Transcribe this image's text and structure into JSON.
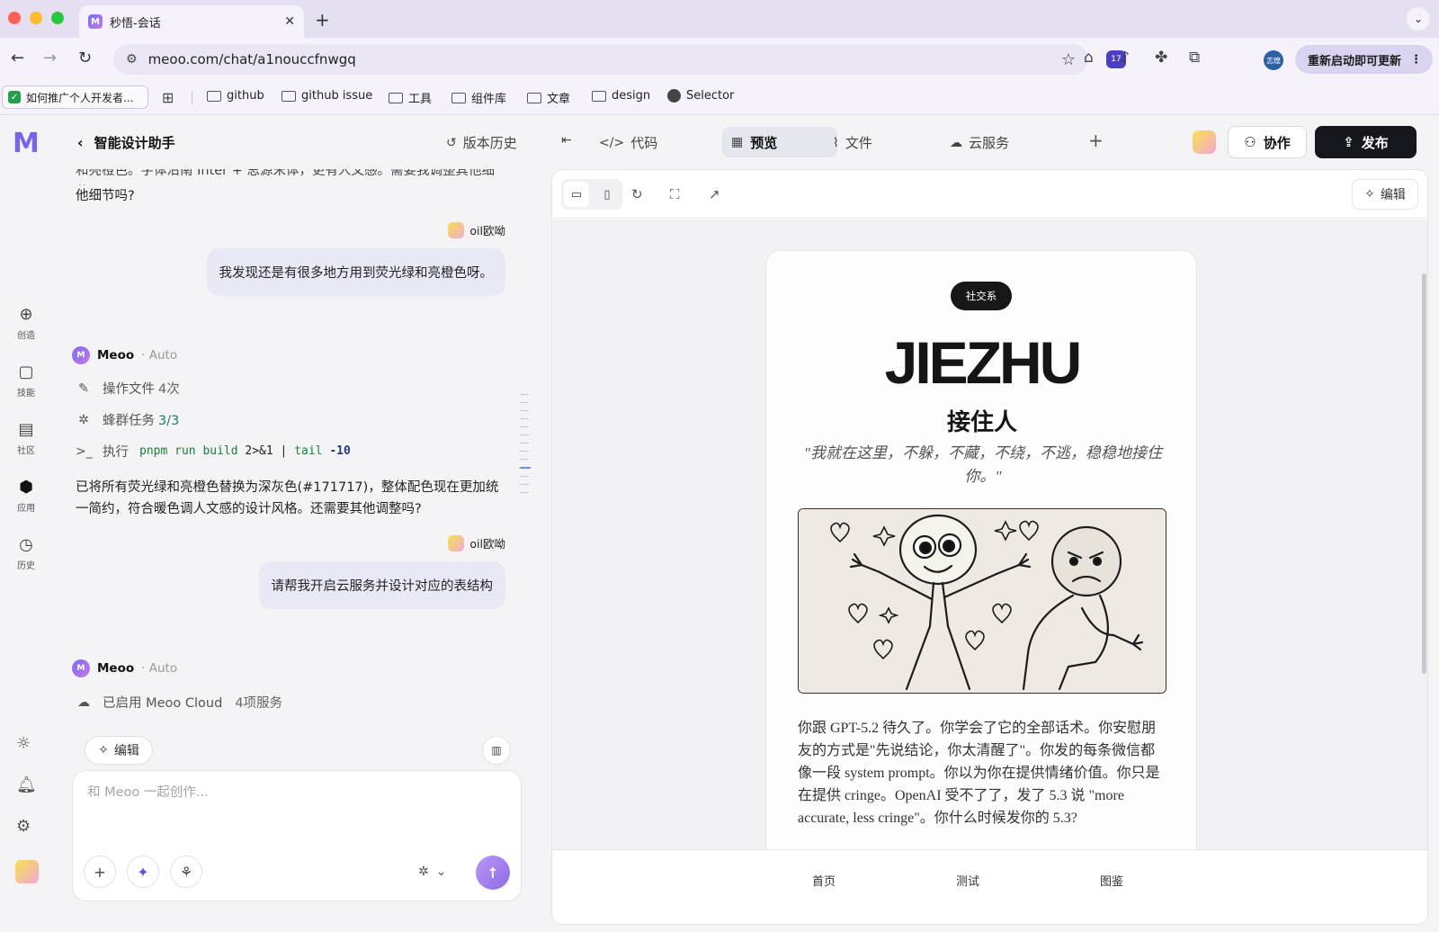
{
  "browser": {
    "tab_title": "秒悟-会话",
    "url": "meoo.com/chat/a1nouccfnwgq",
    "update_label": "重新启动即可更新",
    "extension_badge": "17",
    "profile_label": "志煌",
    "bookmarks": [
      "如何推广个人开发者...",
      "github",
      "github issue",
      "工具",
      "组件库",
      "文章",
      "design",
      "Selector"
    ]
  },
  "rail": {
    "items": [
      "创造",
      "技能",
      "社区",
      "应用",
      "历史"
    ]
  },
  "topbar": {
    "title": "智能设计助手",
    "version_history": "版本历史",
    "code": "代码",
    "preview": "预览",
    "files": "文件",
    "cloud": "云服务",
    "collab": "协作",
    "publish": "发布"
  },
  "chat": {
    "cut_text": "和亮橙色。字体沿南 Inter + 思源宋体，更有人文感。需要我调整其他细节吗?",
    "cut_text_tail": "他细节吗?",
    "user_name": "oil欧呦",
    "user_msg_1": "我发现还是有很多地方用到荧光绿和亮橙色呀。",
    "assistant_name": "Meoo",
    "assistant_mode": "Auto",
    "step_files_label": "操作文件",
    "step_files_count": "4次",
    "step_swarm_label": "蜂群任务",
    "step_swarm_count": "3/3",
    "step_exec_label": "执行",
    "step_exec_cmd": "pnpm run build",
    "step_exec_redirect": "2>&1",
    "step_exec_pipe": "|",
    "step_exec_tail": "tail",
    "step_exec_arg": "-10",
    "reply_text": "已将所有荧光绿和亮橙色替换为深灰色(#171717)，整体配色现在更加统一简约，符合暖色调人文感的设计风格。还需要其他调整吗?",
    "user_msg_2": "请帮我开启云服务并设计对应的表结构",
    "cloud_label": "已启用 Meoo Cloud",
    "cloud_count": "4项服务",
    "edit_chip": "编辑",
    "composer_placeholder": "和 Meoo 一起创作..."
  },
  "preview": {
    "edit_label": "编辑",
    "badge": "社交系",
    "headline": "JIEZHU",
    "subhead": "接住人",
    "quote": "\"我就在这里，不躲，不藏，不绕，不逃，稳稳地接住你。\"",
    "body": "你跟 GPT-5.2 待久了。你学会了它的全部话术。你安慰朋友的方式是\"先说结论，你太清醒了\"。你发的每条微信都像一段 system prompt。你以为你在提供情绪价值。你只是在提供 cringe。OpenAI 受不了了，发了 5.3 说 \"more accurate, less cringe\"。你什么时候发你的 5.3?",
    "nav": [
      "首页",
      "测试",
      "图鉴"
    ]
  },
  "colors": {
    "accent": "#7766e8",
    "dark": "#171717",
    "green": "#14865a"
  }
}
